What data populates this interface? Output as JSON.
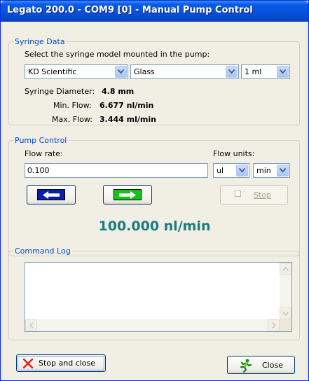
{
  "window": {
    "title": "Legato 200.0 - COM9 [0] - Manual Pump Control"
  },
  "syringe": {
    "group_label": "Syringe Data",
    "prompt": "Select the syringe model mounted in the pump:",
    "manufacturer": "KD Scientific",
    "material": "Glass",
    "volume": "1 ml",
    "diameter_label": "Syringe Diameter:",
    "diameter_value": "4.8 mm",
    "min_flow_label": "Min. Flow:",
    "min_flow_value": "6.677 nl/min",
    "max_flow_label": "Max. Flow:",
    "max_flow_value": "3.444 ml/min"
  },
  "pump": {
    "group_label": "Pump Control",
    "flow_rate_label": "Flow rate:",
    "flow_rate_value": "0.100",
    "flow_units_label": "Flow units:",
    "unit_volume": "ul",
    "unit_time": "min",
    "stop_label": "Stop",
    "current_rate": "100.000 nl/min"
  },
  "log": {
    "group_label": "Command Log"
  },
  "buttons": {
    "stop_close": "Stop and close",
    "close": "Close"
  },
  "colors": {
    "arrow_left": "#0a1fa8",
    "arrow_right": "#16c21a",
    "rate_text": "#1a7c82",
    "group_label": "#0046d5"
  },
  "icons": {
    "stop_close": "red-x-icon",
    "close": "running-man-icon"
  }
}
